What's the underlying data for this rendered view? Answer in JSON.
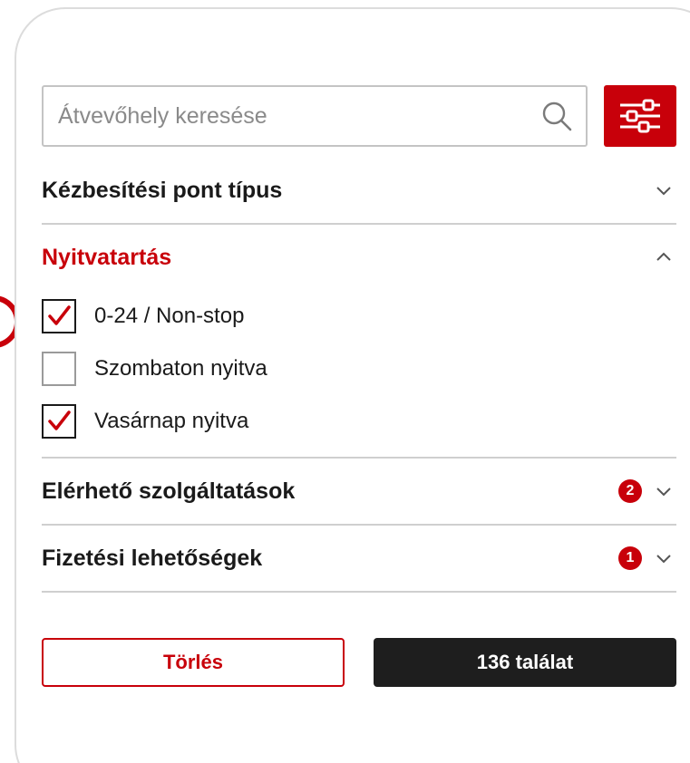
{
  "search": {
    "placeholder": "Átvevőhely keresése"
  },
  "sections": {
    "type": {
      "title": "Kézbesítési pont típus",
      "expanded": false
    },
    "opening": {
      "title": "Nyitvatartás",
      "expanded": true,
      "options": [
        {
          "label": "0-24 / Non-stop",
          "checked": true
        },
        {
          "label": "Szombaton nyitva",
          "checked": false
        },
        {
          "label": "Vasárnap nyitva",
          "checked": true
        }
      ]
    },
    "services": {
      "title": "Elérhető szolgáltatások",
      "badge": "2",
      "expanded": false
    },
    "payment": {
      "title": "Fizetési lehetőségek",
      "badge": "1",
      "expanded": false
    }
  },
  "buttons": {
    "clear_label": "Törlés",
    "results_label": "136 találat"
  },
  "icons": {
    "search": "search-icon",
    "filter": "sliders-icon",
    "chevron_down": "chevron-down-icon",
    "chevron_up": "chevron-up-icon",
    "check": "checkmark-icon"
  },
  "colors": {
    "accent": "#c8000a",
    "dark_button": "#1e1e1e",
    "divider": "#cfcfcf"
  }
}
